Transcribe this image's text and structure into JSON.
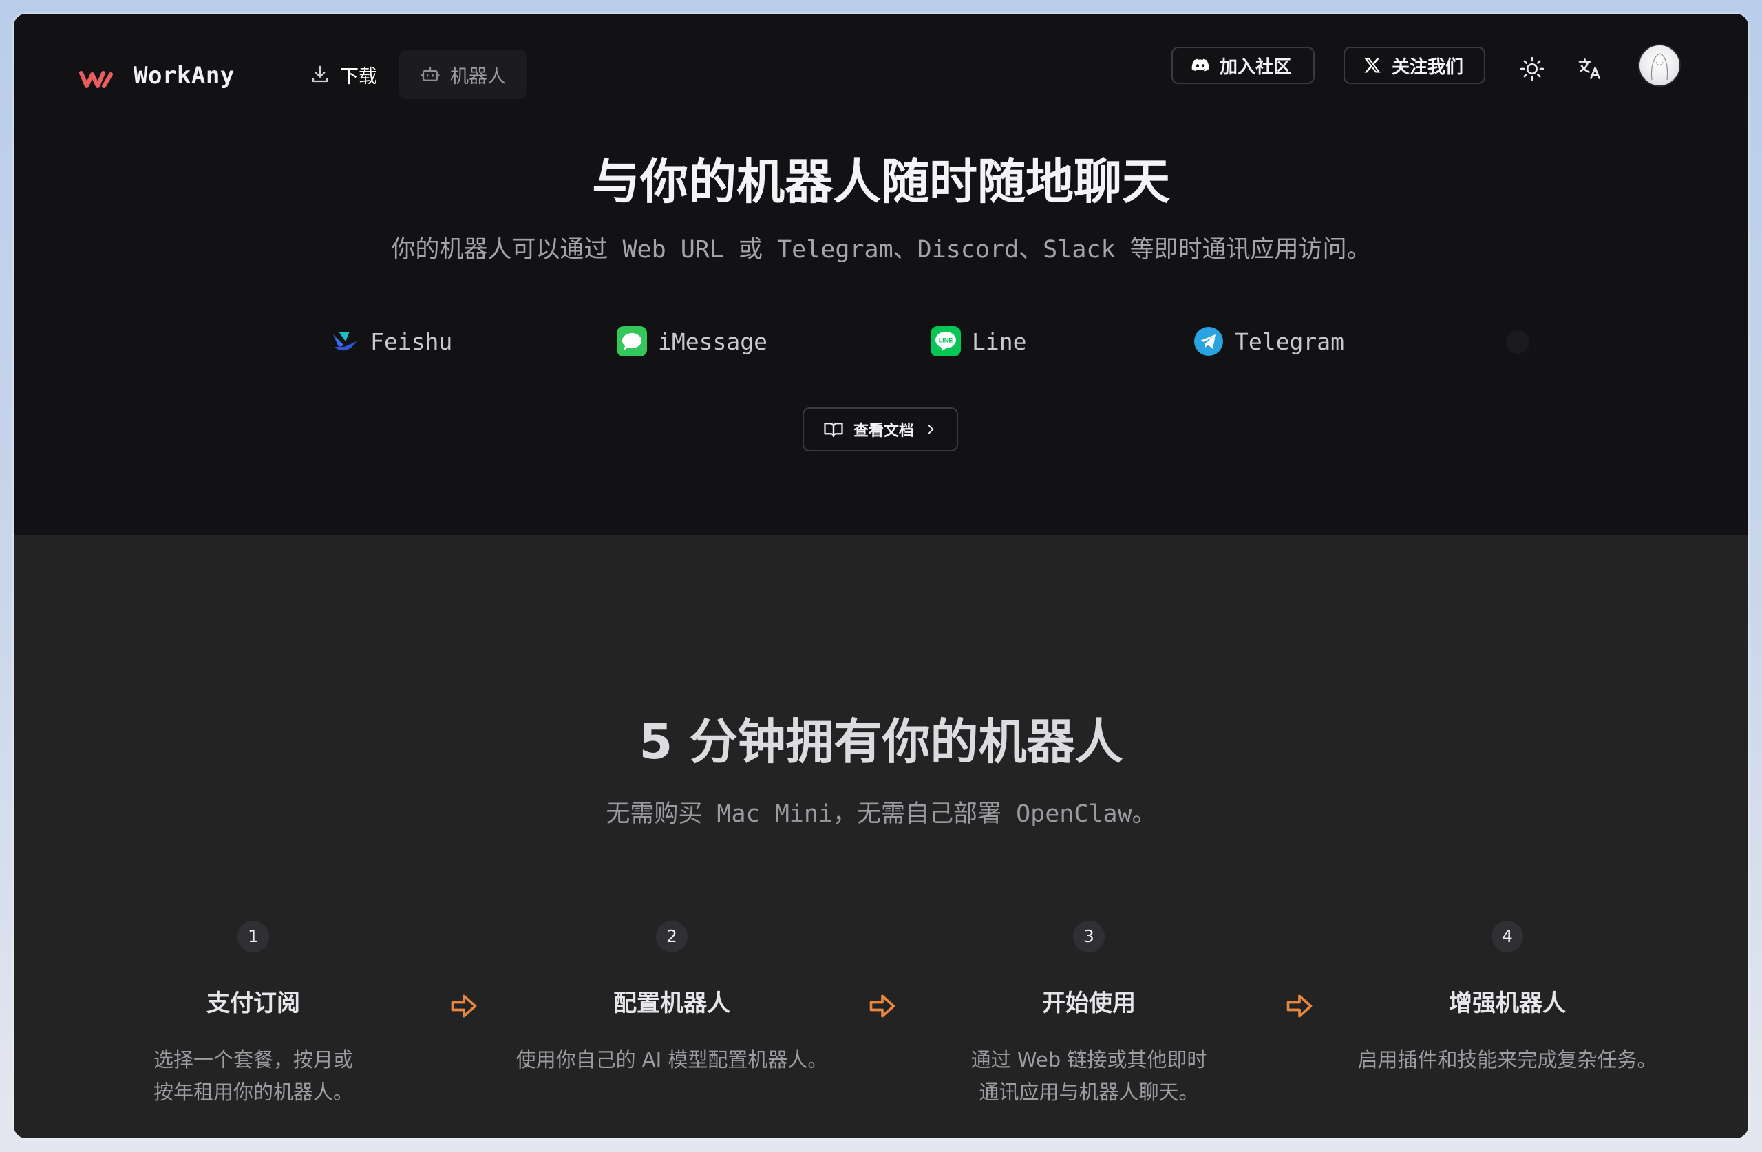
{
  "header": {
    "brand": "WorkAny",
    "nav": {
      "download_label": "下载",
      "bots_label": "机器人"
    },
    "community_label": "加入社区",
    "follow_label": "关注我们"
  },
  "hero": {
    "title": "与你的机器人随时随地聊天",
    "subtitle": "你的机器人可以通过 Web URL 或 Telegram、Discord、Slack 等即时通讯应用访问。",
    "platforms": [
      {
        "name": "Feishu",
        "icon": "feishu-icon"
      },
      {
        "name": "iMessage",
        "icon": "imessage-icon"
      },
      {
        "name": "Line",
        "icon": "line-icon"
      },
      {
        "name": "Telegram",
        "icon": "telegram-icon"
      }
    ],
    "docs_label": "查看文档"
  },
  "setup": {
    "title": "5 分钟拥有你的机器人",
    "subtitle": "无需购买 Mac Mini，无需自己部署 OpenClaw。",
    "steps": [
      {
        "number": "1",
        "title": "支付订阅",
        "line1": "选择一个套餐，按月或",
        "line2": "按年租用你的机器人。"
      },
      {
        "number": "2",
        "title": "配置机器人",
        "line1": "使用你自己的 AI 模型配置机器人。",
        "line2": ""
      },
      {
        "number": "3",
        "title": "开始使用",
        "line1": "通过 Web 链接或其他即时",
        "line2": "通讯应用与机器人聊天。"
      },
      {
        "number": "4",
        "title": "增强机器人",
        "line1": "启用插件和技能来完成复杂任务。",
        "line2": ""
      }
    ]
  },
  "colors": {
    "brand_accent": "#e85d5d",
    "arrow_accent": "#e8873f",
    "top_bg": "#121214",
    "bottom_bg": "#232324"
  }
}
